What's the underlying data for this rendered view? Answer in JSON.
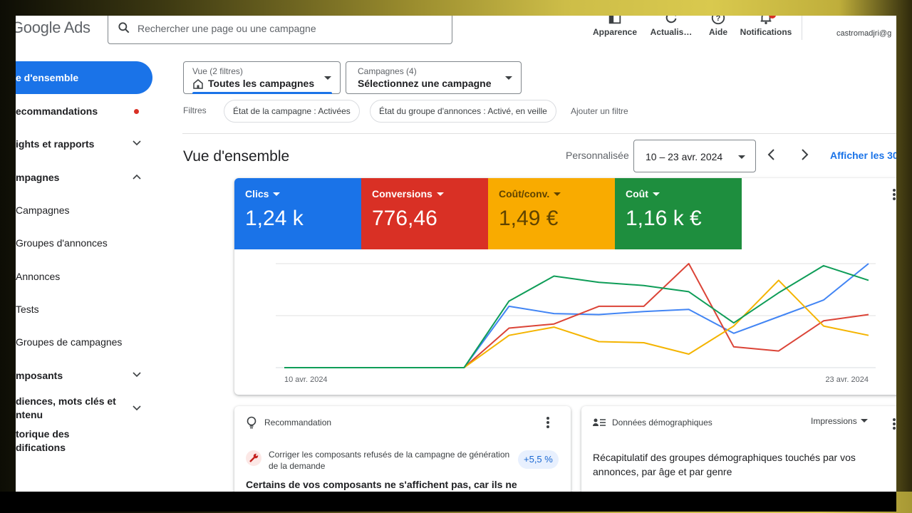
{
  "topbar": {
    "logo": "Google Ads",
    "search_placeholder": "Rechercher une page ou une campagne",
    "actions": [
      {
        "label": "Apparence",
        "icon": "appearance-icon"
      },
      {
        "label": "Actualis…",
        "icon": "refresh-icon"
      },
      {
        "label": "Aide",
        "icon": "help-icon"
      },
      {
        "label": "Notifications",
        "icon": "bell-icon"
      }
    ],
    "account_email": "castromadjri@g"
  },
  "sidebar": {
    "items": [
      {
        "label": "e d'ensemble",
        "active": true
      },
      {
        "label": "ecommandations",
        "dot": true
      },
      {
        "label": "ights et rapports",
        "chevron": "down"
      },
      {
        "label": "mpagnes",
        "chevron": "up"
      },
      {
        "label": "Campagnes"
      },
      {
        "label": "Groupes d'annonces"
      },
      {
        "label": "Annonces"
      },
      {
        "label": "Tests"
      },
      {
        "label": "Groupes de campagnes"
      },
      {
        "label": "mposants",
        "chevron": "down"
      },
      {
        "label": "diences, mots clés et ntenu",
        "chevron": "down"
      },
      {
        "label": "torique des difications"
      }
    ]
  },
  "filters": {
    "view_small": "Vue (2 filtres)",
    "view_value": "Toutes les campagnes",
    "campaigns_small": "Campagnes (4)",
    "campaigns_value": "Sélectionnez une campagne",
    "filters_label": "Filtres",
    "chips": [
      "État de la campagne : Activées",
      "État du groupe d'annonces : Activé, en veille"
    ],
    "add_filter": "Ajouter un filtre"
  },
  "overview": {
    "title": "Vue d'ensemble",
    "personalized": "Personnalisée",
    "date_range": "10 – 23 avr. 2024",
    "show_all": "Afficher les 30"
  },
  "metrics": [
    {
      "label": "Clics",
      "value": "1,24 k",
      "color": "#1a73e8"
    },
    {
      "label": "Conversions",
      "value": "776,46",
      "color": "#d93025"
    },
    {
      "label": "Coût/conv.",
      "value": "1,49 €",
      "color": "#f9ab00"
    },
    {
      "label": "Coût",
      "value": "1,16 k €",
      "color": "#1e8e3e"
    }
  ],
  "chart_data": {
    "type": "line",
    "x": [
      "10 avr. 2024",
      "11",
      "12",
      "13",
      "14",
      "15",
      "16",
      "17",
      "18",
      "19",
      "20",
      "21",
      "22",
      "23 avr. 2024"
    ],
    "x_tick_labels": [
      "10 avr. 2024",
      "23 avr. 2024"
    ],
    "ylim": [
      0,
      100
    ],
    "grid": true,
    "series": [
      {
        "color": "#4285f4",
        "values": [
          0,
          0,
          0,
          0,
          0,
          59,
          52,
          51,
          54,
          56,
          33,
          49,
          65,
          100
        ]
      },
      {
        "color": "#db4437",
        "values": [
          0,
          0,
          0,
          0,
          0,
          38,
          42,
          59,
          59,
          100,
          20,
          16,
          45,
          51
        ]
      },
      {
        "color": "#f4b400",
        "values": [
          0,
          0,
          0,
          0,
          0,
          31,
          39,
          25,
          24,
          13,
          40,
          84,
          40,
          31
        ]
      },
      {
        "color": "#0f9d58",
        "values": [
          0,
          0,
          0,
          0,
          0,
          64,
          88,
          82,
          79,
          73,
          43,
          72,
          98,
          84
        ]
      }
    ]
  },
  "recommendation": {
    "header": "Recommandation",
    "text": "Corriger les composants refusés de la campagne de génération de la demande",
    "uplift": "+5,5 %",
    "main": "Certains de vos composants ne s'affichent pas, car ils ne"
  },
  "demographics": {
    "header": "Données démographiques",
    "metric": "Impressions",
    "text": "Récapitulatif des groupes démographiques touchés par vos annonces, par âge et par genre"
  }
}
